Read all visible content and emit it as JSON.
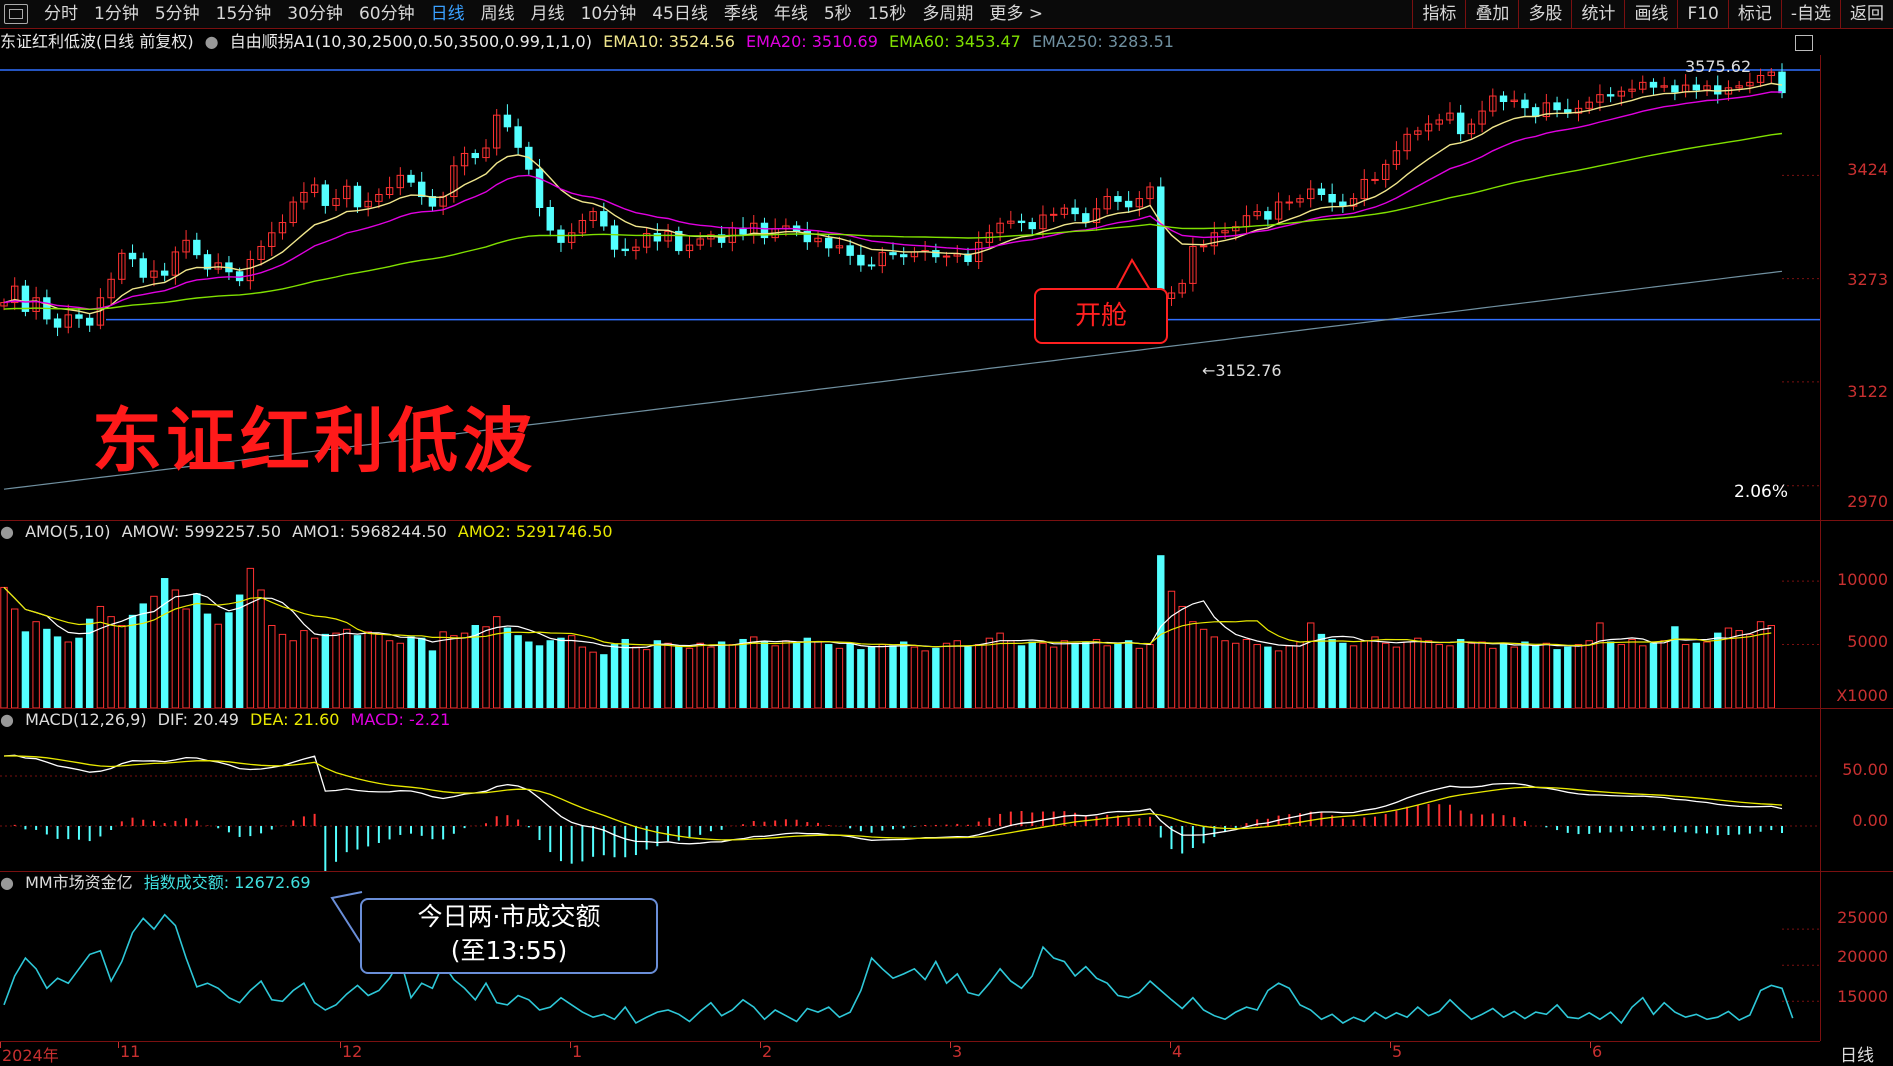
{
  "toolbar": {
    "left_items": [
      "分时",
      "1分钟",
      "5分钟",
      "15分钟",
      "30分钟",
      "60分钟",
      "日线",
      "周线",
      "月线",
      "10分钟",
      "45日线",
      "季线",
      "年线",
      "5秒",
      "15秒",
      "多周期",
      "更多 >"
    ],
    "active": "日线",
    "right_items": [
      "指标",
      "叠加",
      "多股",
      "统计",
      "画线",
      "F10",
      "标记",
      "-自选",
      "返回"
    ]
  },
  "info": {
    "name": "东证红利低波(日线 前复权)",
    "indicator": "自由顺拐A1(10,30,2500,0.50,3500,0.99,1,1,0)",
    "ema10": "EMA10: 3524.56",
    "ema20": "EMA20: 3510.69",
    "ema60": "EMA60: 3453.47",
    "ema250": "EMA250: 3283.51"
  },
  "colors": {
    "up": "#ff3232",
    "down": "#54ffff",
    "ema10": "#f0e68c",
    "ema20": "#e000e0",
    "ema60": "#80e000",
    "ema250": "#7090a0",
    "axis": "#c83030",
    "box": "#3070ff"
  },
  "price_axis": [
    "3424",
    "3273",
    "3122",
    "2970"
  ],
  "price_annot": {
    "high": "3575.62",
    "low": "3152.76",
    "pct": "2.06%"
  },
  "title_overlay": "东证红利低波",
  "callout_open": "开舱",
  "amo": {
    "label": "AMO(5,10)",
    "amow": "AMOW: 5992257.50",
    "amo1": "AMO1: 5968244.50",
    "amo2": "AMO2: 5291746.50",
    "axis": [
      "10000",
      "5000"
    ],
    "unit": "X1000"
  },
  "macd": {
    "label": "MACD(12,26,9)",
    "dif": "DIF: 20.49",
    "dea": "DEA: 21.60",
    "macd": "MACD: -2.21",
    "axis": [
      "50.00",
      "0.00"
    ]
  },
  "mm": {
    "label": "MM市场资金亿",
    "value": "指数成交额: 12672.69",
    "axis": [
      "25000",
      "20000",
      "15000"
    ]
  },
  "callout_vol": {
    "line1": "今日两·市成交额",
    "line2": "(至13:55)"
  },
  "x_axis": [
    "2024年",
    "11",
    "12",
    "1",
    "2",
    "3",
    "4",
    "5",
    "6"
  ],
  "x_btn": "日线",
  "chart_data": {
    "type": "candlestick",
    "price_range": [
      2920,
      3600
    ],
    "amo_range": [
      0,
      13000
    ],
    "macd_range": [
      -45,
      95
    ],
    "mm_range": [
      9500,
      30000
    ],
    "price": [
      3238,
      3262,
      3225,
      3245,
      3214,
      3202,
      3220,
      3215,
      3205,
      3245,
      3272,
      3310,
      3302,
      3275,
      3284,
      3278,
      3312,
      3329,
      3308,
      3287,
      3296,
      3283,
      3270,
      3301,
      3320,
      3340,
      3355,
      3385,
      3399,
      3410,
      3380,
      3390,
      3408,
      3378,
      3386,
      3396,
      3406,
      3424,
      3414,
      3393,
      3379,
      3393,
      3438,
      3456,
      3450,
      3464,
      3512,
      3495,
      3465,
      3433,
      3377,
      3344,
      3326,
      3340,
      3358,
      3371,
      3350,
      3316,
      3314,
      3319,
      3339,
      3328,
      3342,
      3314,
      3322,
      3331,
      3337,
      3326,
      3347,
      3338,
      3354,
      3333,
      3346,
      3350,
      3342,
      3327,
      3332,
      3318,
      3321,
      3307,
      3293,
      3292,
      3311,
      3308,
      3305,
      3312,
      3314,
      3305,
      3306,
      3309,
      3298,
      3326,
      3340,
      3354,
      3357,
      3355,
      3346,
      3366,
      3367,
      3376,
      3368,
      3355,
      3375,
      3393,
      3386,
      3378,
      3390,
      3407,
      3244,
      3252,
      3266,
      3320,
      3321,
      3340,
      3343,
      3349,
      3365,
      3371,
      3360,
      3385,
      3385,
      3390,
      3404,
      3396,
      3385,
      3379,
      3390,
      3418,
      3418,
      3440,
      3460,
      3484,
      3489,
      3499,
      3505,
      3515,
      3485,
      3499,
      3518,
      3540,
      3532,
      3534,
      3523,
      3510,
      3530,
      3520,
      3515,
      3522,
      3531,
      3542,
      3540,
      3547,
      3550,
      3560,
      3553,
      3555,
      3546,
      3556,
      3549,
      3555,
      3543,
      3552,
      3555,
      3560,
      3570,
      3575,
      3545
    ],
    "volume": [
      9500,
      7800,
      6000,
      6800,
      6200,
      5600,
      5200,
      5500,
      7000,
      8000,
      7200,
      6500,
      7300,
      8200,
      8800,
      10200,
      9300,
      7800,
      9000,
      7400,
      6600,
      7500,
      8900,
      11000,
      9300,
      6500,
      5800,
      5300,
      6100,
      5500,
      5800,
      5900,
      6200,
      5700,
      6000,
      5800,
      5300,
      5100,
      5600,
      5500,
      4500,
      6000,
      5700,
      5900,
      6500,
      6400,
      7200,
      6300,
      5700,
      5200,
      4900,
      5300,
      5500,
      5700,
      4800,
      4400,
      4200,
      5000,
      5400,
      4800,
      4600,
      5300,
      5100,
      4900,
      4700,
      5100,
      4800,
      5200,
      5000,
      5400,
      5600,
      5200,
      4900,
      5300,
      5100,
      5500,
      5200,
      5000,
      4700,
      5100,
      4600,
      4800,
      5000,
      4900,
      5200,
      4800,
      4500,
      4700,
      5100,
      5300,
      4800,
      5000,
      5500,
      5900,
      5300,
      4900,
      5200,
      5100,
      4800,
      5300,
      5000,
      5200,
      5400,
      4900,
      5100,
      5300,
      4700,
      5000,
      12000,
      9200,
      8000,
      6800,
      6200,
      5600,
      5300,
      5100,
      5400,
      5000,
      4800,
      4500,
      4900,
      5200,
      6700,
      5800,
      5400,
      5100,
      4900,
      5300,
      5600,
      5100,
      4800,
      5200,
      5500,
      5300,
      5000,
      4900,
      5400,
      5100,
      5200,
      4700,
      5000,
      4800,
      5200,
      4900,
      5100,
      4600,
      4800,
      5000,
      5300,
      6700,
      5200,
      5000,
      5400,
      4900,
      5100,
      5300,
      6400,
      5000,
      5100,
      5200,
      5900,
      6300,
      6100,
      5800,
      6800,
      6500
    ],
    "mm": [
      14500,
      18500,
      21000,
      19500,
      16800,
      18200,
      17500,
      19500,
      21500,
      22000,
      17800,
      20500,
      24500,
      26500,
      25000,
      27000,
      25500,
      21000,
      17000,
      17500,
      16800,
      15500,
      14800,
      16500,
      17800,
      15200,
      15000,
      16500,
      17500,
      14800,
      13800,
      14500,
      16000,
      17200,
      15800,
      16500,
      18200,
      20800,
      15500,
      17500,
      16800,
      20200,
      18000,
      16800,
      15200,
      17500,
      14800,
      14500,
      15800,
      15200,
      13800,
      14200,
      15500,
      14500,
      13500,
      12800,
      13200,
      12500,
      14200,
      12000,
      12800,
      13500,
      13800,
      13200,
      12200,
      13600,
      14800,
      13000,
      13800,
      15200,
      14200,
      12500,
      13800,
      13000,
      12200,
      14000,
      13500,
      14200,
      12800,
      13500,
      16500,
      21000,
      19500,
      18200,
      18800,
      19500,
      18000,
      20500,
      17500,
      18800,
      16200,
      15800,
      17500,
      19500,
      17800,
      16800,
      18500,
      22500,
      21000,
      20500,
      18500,
      19800,
      18200,
      17500,
      15800,
      15500,
      16200,
      17800,
      16500,
      15200,
      14000,
      15500,
      13800,
      13000,
      12500,
      13500,
      14200,
      13800,
      16500,
      17500,
      16800,
      14500,
      13800,
      12500,
      13200,
      12000,
      12800,
      12200,
      13500,
      12600,
      13400,
      12800,
      14200,
      13000,
      13600,
      15200,
      13800,
      12500,
      13200,
      14000,
      12800,
      13600,
      12600,
      13500,
      13200,
      14500,
      12800,
      12600,
      13400,
      12500,
      13500,
      12000,
      14200,
      15500,
      13200,
      14800,
      13500,
      12800,
      13200,
      12500,
      12800,
      13600,
      12400,
      13100,
      16500,
      17200,
      16800,
      12672
    ]
  }
}
